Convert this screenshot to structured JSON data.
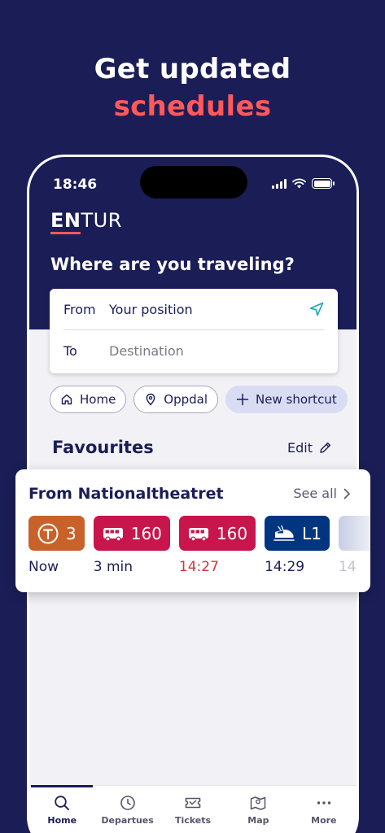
{
  "promo": {
    "line1": "Get updated",
    "line2": "schedules"
  },
  "status": {
    "time": "18:46"
  },
  "app": {
    "logo_en": "EN",
    "logo_tur": "TUR",
    "question": "Where are you traveling?"
  },
  "search": {
    "from_label": "From",
    "from_value": "Your position",
    "to_label": "To",
    "to_placeholder": "Destination"
  },
  "shortcuts": [
    {
      "label": "Home",
      "icon": "home-icon"
    },
    {
      "label": "Oppdal",
      "icon": "location-pin-icon"
    },
    {
      "label": "New shortcut",
      "icon": "plus-icon"
    }
  ],
  "favourites": {
    "title": "Favourites",
    "edit_label": "Edit"
  },
  "stop_card": {
    "title": "From Nationaltheatret",
    "see_all": "See all",
    "departures": [
      {
        "line": "3",
        "mode": "tram",
        "icon": "tram-icon",
        "time": "Now",
        "late": false,
        "color": "#c9622a"
      },
      {
        "line": "160",
        "mode": "bus",
        "icon": "bus-icon",
        "time": "3 min",
        "late": false,
        "color": "#c8154b"
      },
      {
        "line": "160",
        "mode": "bus",
        "icon": "bus-icon",
        "time": "14:27",
        "late": true,
        "color": "#c8154b"
      },
      {
        "line": "L1",
        "mode": "train",
        "icon": "train-icon",
        "time": "14:29",
        "late": false,
        "color": "#00367f"
      }
    ],
    "partial_time": "14"
  },
  "nav": [
    {
      "label": "Home",
      "icon": "search-icon",
      "active": true
    },
    {
      "label": "Departues",
      "icon": "clock-icon",
      "active": false
    },
    {
      "label": "Tickets",
      "icon": "ticket-icon",
      "active": false
    },
    {
      "label": "Map",
      "icon": "map-icon",
      "active": false
    },
    {
      "label": "More",
      "icon": "more-dots-icon",
      "active": false
    }
  ],
  "colors": {
    "navy": "#1b1d57",
    "accent_red": "#ff5959",
    "late_red": "#d0363c",
    "chip_new_bg": "#d9ddf3"
  }
}
